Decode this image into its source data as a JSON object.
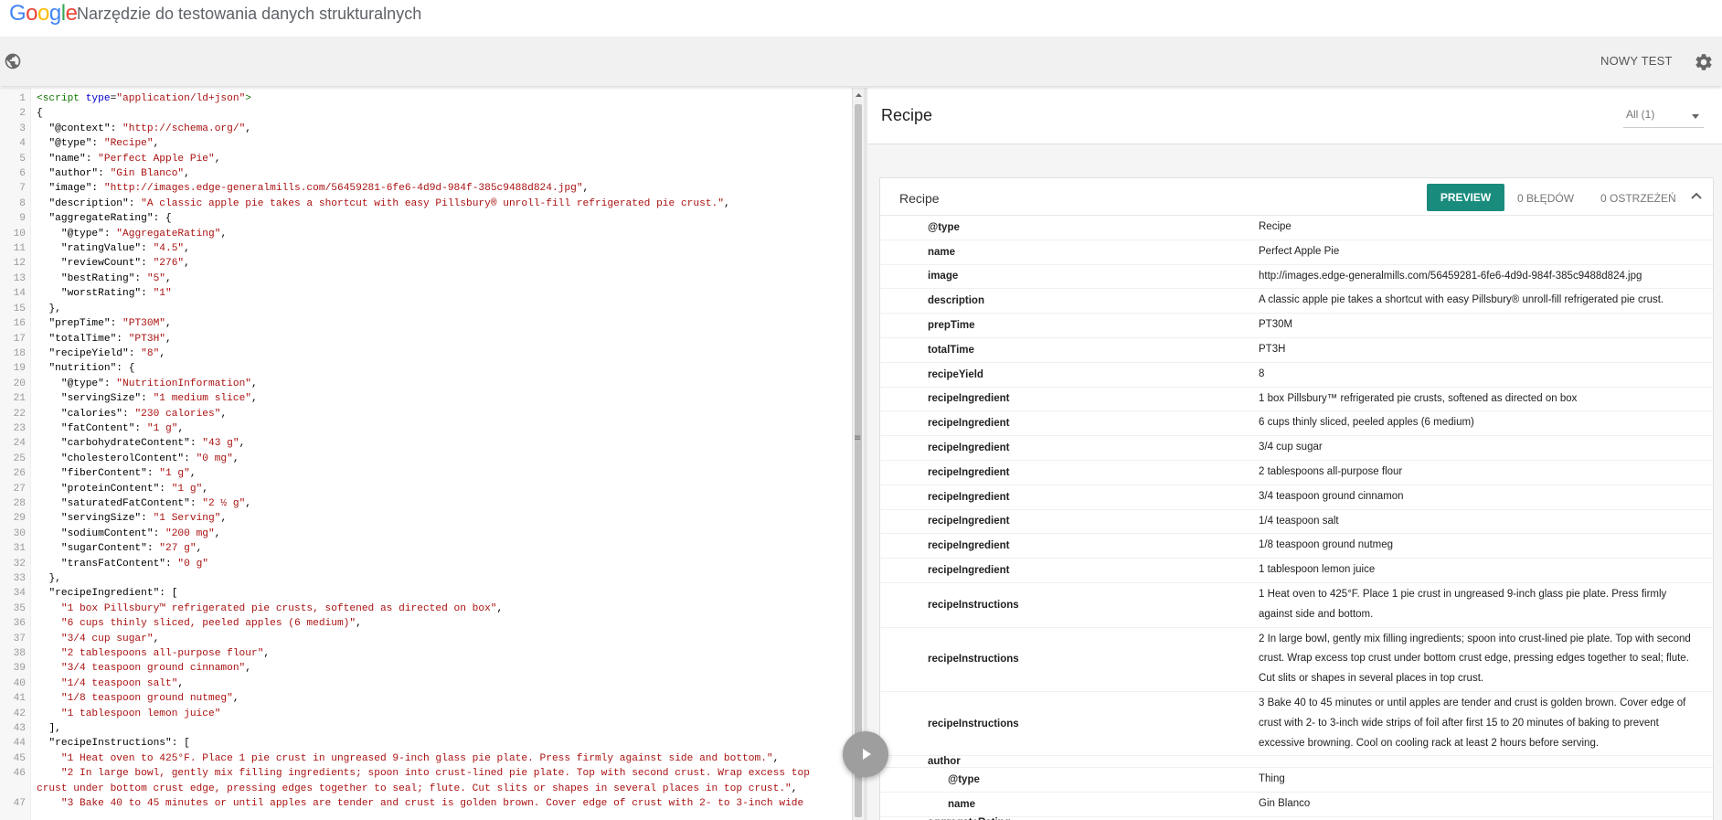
{
  "header": {
    "logo": [
      {
        "ch": "G",
        "color": "#4285F4"
      },
      {
        "ch": "o",
        "color": "#EA4335"
      },
      {
        "ch": "o",
        "color": "#FBBC05"
      },
      {
        "ch": "g",
        "color": "#4285F4"
      },
      {
        "ch": "l",
        "color": "#34A853"
      },
      {
        "ch": "e",
        "color": "#EA4335"
      }
    ],
    "title": "Narzędzie do testowania danych strukturalnych"
  },
  "toolbar": {
    "new_test_label": "NOWY TEST",
    "globe_icon": "globe-icon",
    "settings_icon": "gear-icon"
  },
  "editor": {
    "lines": [
      {
        "n": "1",
        "html": "<span class=\"tk-tag\">&lt;script</span> <span class=\"tk-attr\">type</span>=<span class=\"tk-str\">\"application/ld+json\"</span><span class=\"tk-tag\">&gt;</span>"
      },
      {
        "n": "2",
        "html": "{"
      },
      {
        "n": "3",
        "html": "  \"@context\": <span class=\"tk-str\">\"http://schema.org/\"</span>,"
      },
      {
        "n": "4",
        "html": "  \"@type\": <span class=\"tk-str\">\"Recipe\"</span>,"
      },
      {
        "n": "5",
        "html": "  \"name\": <span class=\"tk-str\">\"Perfect Apple Pie\"</span>,"
      },
      {
        "n": "6",
        "html": "  \"author\": <span class=\"tk-str\">\"Gin Blanco\"</span>,"
      },
      {
        "n": "7",
        "html": "  \"image\": <span class=\"tk-str\">\"http://images.edge-generalmills.com/56459281-6fe6-4d9d-984f-385c9488d824.jpg\"</span>,"
      },
      {
        "n": "8",
        "html": "  \"description\": <span class=\"tk-str\">\"A classic apple pie takes a shortcut with easy Pillsbury® unroll-fill refrigerated pie crust.\"</span>,"
      },
      {
        "n": "9",
        "html": "  \"aggregateRating\": {"
      },
      {
        "n": "10",
        "html": "    \"@type\": <span class=\"tk-str\">\"AggregateRating\"</span>,"
      },
      {
        "n": "11",
        "html": "    \"ratingValue\": <span class=\"tk-str\">\"4.5\"</span>,"
      },
      {
        "n": "12",
        "html": "    \"reviewCount\": <span class=\"tk-str\">\"276\"</span>,"
      },
      {
        "n": "13",
        "html": "    \"bestRating\": <span class=\"tk-str\">\"5\"</span>,"
      },
      {
        "n": "14",
        "html": "    \"worstRating\": <span class=\"tk-str\">\"1\"</span>"
      },
      {
        "n": "15",
        "html": "  },"
      },
      {
        "n": "16",
        "html": "  \"prepTime\": <span class=\"tk-str\">\"PT30M\"</span>,"
      },
      {
        "n": "17",
        "html": "  \"totalTime\": <span class=\"tk-str\">\"PT3H\"</span>,"
      },
      {
        "n": "18",
        "html": "  \"recipeYield\": <span class=\"tk-str\">\"8\"</span>,"
      },
      {
        "n": "19",
        "html": "  \"nutrition\": {"
      },
      {
        "n": "20",
        "html": "    \"@type\": <span class=\"tk-str\">\"NutritionInformation\"</span>,"
      },
      {
        "n": "21",
        "html": "    \"servingSize\": <span class=\"tk-str\">\"1 medium slice\"</span>,"
      },
      {
        "n": "22",
        "html": "    \"calories\": <span class=\"tk-str\">\"230 calories\"</span>,"
      },
      {
        "n": "23",
        "html": "    \"fatContent\": <span class=\"tk-str\">\"1 g\"</span>,"
      },
      {
        "n": "24",
        "html": "    \"carbohydrateContent\": <span class=\"tk-str\">\"43 g\"</span>,"
      },
      {
        "n": "25",
        "html": "    \"cholesterolContent\": <span class=\"tk-str\">\"0 mg\"</span>,"
      },
      {
        "n": "26",
        "html": "    \"fiberContent\": <span class=\"tk-str\">\"1 g\"</span>,"
      },
      {
        "n": "27",
        "html": "    \"proteinContent\": <span class=\"tk-str\">\"1 g\"</span>,"
      },
      {
        "n": "28",
        "html": "    \"saturatedFatContent\": <span class=\"tk-str\">\"2 ½ g\"</span>,"
      },
      {
        "n": "29",
        "html": "    \"servingSize\": <span class=\"tk-str\">\"1 Serving\"</span>,"
      },
      {
        "n": "30",
        "html": "    \"sodiumContent\": <span class=\"tk-str\">\"200 mg\"</span>,"
      },
      {
        "n": "31",
        "html": "    \"sugarContent\": <span class=\"tk-str\">\"27 g\"</span>,"
      },
      {
        "n": "32",
        "html": "    \"transFatContent\": <span class=\"tk-str\">\"0 g\"</span>"
      },
      {
        "n": "33",
        "html": "  },"
      },
      {
        "n": "34",
        "html": "  \"recipeIngredient\": ["
      },
      {
        "n": "35",
        "html": "    <span class=\"tk-str\">\"1 box Pillsbury™ refrigerated pie crusts, softened as directed on box\"</span>,"
      },
      {
        "n": "36",
        "html": "    <span class=\"tk-str\">\"6 cups thinly sliced, peeled apples (6 medium)\"</span>,"
      },
      {
        "n": "37",
        "html": "    <span class=\"tk-str\">\"3/4 cup sugar\"</span>,"
      },
      {
        "n": "38",
        "html": "    <span class=\"tk-str\">\"2 tablespoons all-purpose flour\"</span>,"
      },
      {
        "n": "39",
        "html": "    <span class=\"tk-str\">\"3/4 teaspoon ground cinnamon\"</span>,"
      },
      {
        "n": "40",
        "html": "    <span class=\"tk-str\">\"1/4 teaspoon salt\"</span>,"
      },
      {
        "n": "41",
        "html": "    <span class=\"tk-str\">\"1/8 teaspoon ground nutmeg\"</span>,"
      },
      {
        "n": "42",
        "html": "    <span class=\"tk-str\">\"1 tablespoon lemon juice\"</span>"
      },
      {
        "n": "43",
        "html": "  ],"
      },
      {
        "n": "44",
        "html": "  \"recipeInstructions\": ["
      },
      {
        "n": "45",
        "html": "    <span class=\"tk-str\">\"1 Heat oven to 425°F. Place 1 pie crust in ungreased 9-inch glass pie plate. Press firmly against side and bottom.\"</span>,"
      },
      {
        "n": "46",
        "html": "    <span class=\"tk-str\">\"2 In large bowl, gently mix filling ingredients; spoon into crust-lined pie plate. Top with second crust. Wrap excess top crust under bottom crust edge, pressing edges together to seal; flute. Cut slits or shapes in several places in top crust.\"</span>,"
      },
      {
        "n": "47",
        "html": "    <span class=\"tk-str\">\"3 Bake 40 to 45 minutes or until apples are tender and crust is golden brown. Cover edge of crust with 2- to 3-inch wide</span>"
      }
    ]
  },
  "results": {
    "title": "Recipe",
    "filter_label": "All (1)",
    "card": {
      "title": "Recipe",
      "preview_label": "PREVIEW",
      "errors_label": "0 BŁĘDÓW",
      "warnings_label": "0 OSTRZEŻEŃ",
      "rows": [
        {
          "name": "@type",
          "value": "Recipe"
        },
        {
          "name": "name",
          "value": "Perfect Apple Pie"
        },
        {
          "name": "image",
          "value": "http://images.edge-generalmills.com/56459281-6fe6-4d9d-984f-385c9488d824.jpg"
        },
        {
          "name": "description",
          "value": "A classic apple pie takes a shortcut with easy Pillsbury® unroll-fill refrigerated pie crust."
        },
        {
          "name": "prepTime",
          "value": "PT30M"
        },
        {
          "name": "totalTime",
          "value": "PT3H"
        },
        {
          "name": "recipeYield",
          "value": "8"
        },
        {
          "name": "recipeIngredient",
          "value": "1 box Pillsbury™ refrigerated pie crusts, softened as directed on box"
        },
        {
          "name": "recipeIngredient",
          "value": "6 cups thinly sliced, peeled apples (6 medium)"
        },
        {
          "name": "recipeIngredient",
          "value": "3/4 cup sugar"
        },
        {
          "name": "recipeIngredient",
          "value": "2 tablespoons all-purpose flour"
        },
        {
          "name": "recipeIngredient",
          "value": "3/4 teaspoon ground cinnamon"
        },
        {
          "name": "recipeIngredient",
          "value": "1/4 teaspoon salt"
        },
        {
          "name": "recipeIngredient",
          "value": "1/8 teaspoon ground nutmeg"
        },
        {
          "name": "recipeIngredient",
          "value": "1 tablespoon lemon juice"
        },
        {
          "name": "recipeInstructions",
          "value": "1 Heat oven to 425°F. Place 1 pie crust in ungreased 9-inch glass pie plate. Press firmly against side and bottom."
        },
        {
          "name": "recipeInstructions",
          "value": "2 In large bowl, gently mix filling ingredients; spoon into crust-lined pie plate. Top with second crust. Wrap excess top crust under bottom crust edge, pressing edges together to seal; flute. Cut slits or shapes in several places in top crust."
        },
        {
          "name": "recipeInstructions",
          "value": "3 Bake 40 to 45 minutes or until apples are tender and crust is golden brown. Cover edge of crust with 2- to 3-inch wide strips of foil after first 15 to 20 minutes of baking to prevent excessive browning. Cool on cooling rack at least 2 hours before serving."
        },
        {
          "name": "author",
          "value": ""
        },
        {
          "name": "@type",
          "value": "Thing",
          "indent": true
        },
        {
          "name": "name",
          "value": "Gin Blanco",
          "indent": true
        },
        {
          "name": "aggregateRating",
          "value": ""
        }
      ]
    }
  },
  "colors": {
    "preview_button": "#1a8c7e",
    "code_string": "#a11",
    "code_tag": "#170",
    "code_attr": "#00c"
  },
  "icons": {
    "run": "play-icon",
    "collapse": "chevron-up-icon",
    "filter": "caret-down-icon"
  }
}
